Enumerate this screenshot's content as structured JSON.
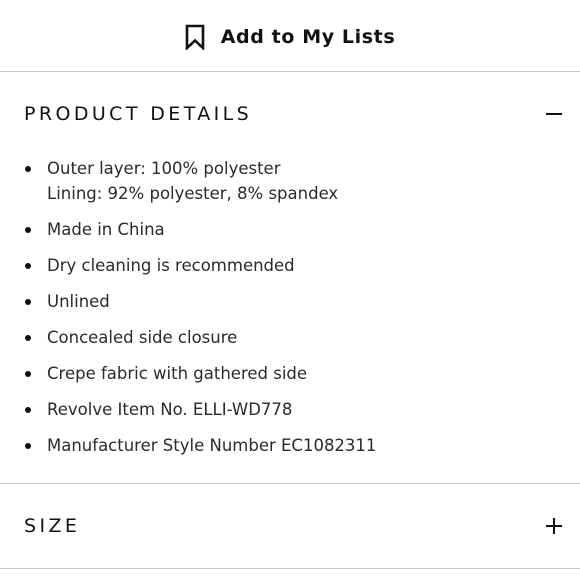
{
  "add_to_lists": {
    "label": "Add to My Lists",
    "icon": "bookmark-icon"
  },
  "product_details": {
    "title": "PRODUCT DETAILS",
    "toggle_icon": "minus-icon",
    "expanded": true,
    "items": [
      {
        "lines": [
          "Outer layer: 100% polyester",
          "Lining: 92% polyester, 8% spandex"
        ]
      },
      {
        "lines": [
          "Made in China"
        ]
      },
      {
        "lines": [
          "Dry cleaning is recommended"
        ]
      },
      {
        "lines": [
          "Unlined"
        ]
      },
      {
        "lines": [
          "Concealed side closure"
        ]
      },
      {
        "lines": [
          "Crepe fabric with gathered side"
        ]
      },
      {
        "lines": [
          "Revolve Item No. ELLI-WD778"
        ]
      },
      {
        "lines": [
          "Manufacturer Style Number EC1082311"
        ]
      }
    ]
  },
  "size_section": {
    "title": "SIZE",
    "toggle_icon": "plus-icon",
    "expanded": false
  },
  "colors": {
    "text": "#111111",
    "body_text": "#2a2a2a",
    "divider": "#c8c8c8",
    "background": "#ffffff"
  }
}
